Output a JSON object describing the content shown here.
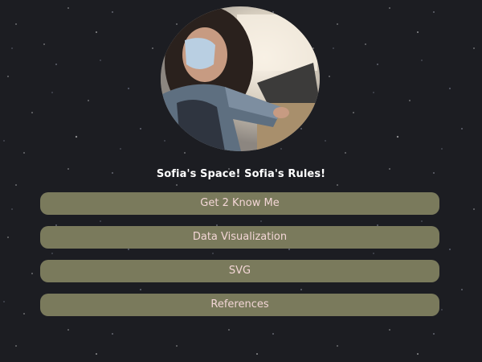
{
  "profile": {
    "avatar_icon": "profile-photo",
    "tagline": "Sofia's Space! Sofia's Rules!"
  },
  "nav": {
    "items": [
      {
        "label": "Get 2 Know Me"
      },
      {
        "label": "Data Visualization"
      },
      {
        "label": "SVG"
      },
      {
        "label": "References"
      }
    ]
  },
  "colors": {
    "background": "#1c1d22",
    "button_bg": "#7a7a5c",
    "button_text": "#f3d6d6",
    "tagline_text": "#ffffff"
  }
}
